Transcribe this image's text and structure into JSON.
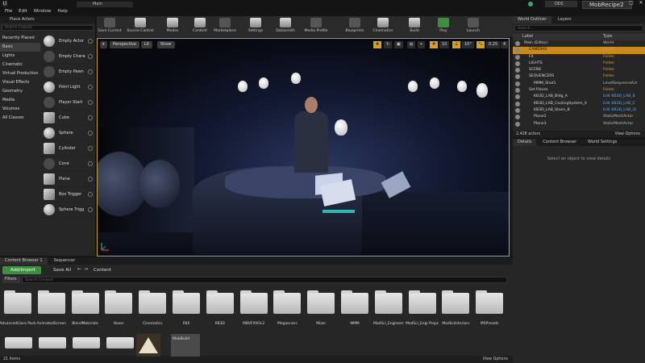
{
  "app": {
    "menu": [
      "File",
      "Edit",
      "Window",
      "Help"
    ],
    "doc_tab": "Main",
    "ddc_label": "DDC",
    "project_tab": "MobRecipe2"
  },
  "place_actors": {
    "title": "Place Actors",
    "search_placeholder": "Search Classes",
    "categories": [
      "Recently Placed",
      "Basic",
      "Lights",
      "Cinematic",
      "Virtual Production",
      "Visual Effects",
      "Geometry",
      "Media",
      "Volumes",
      "All Classes"
    ],
    "active_category": "Basic",
    "actors": [
      "Empty Actor",
      "Empty Chara",
      "Empty Pawn",
      "Point Light",
      "Player Start",
      "Cube",
      "Sphere",
      "Cylinder",
      "Cone",
      "Plane",
      "Box Trigger",
      "Sphere Trigg"
    ]
  },
  "toolbar": {
    "buttons": [
      "Save Current",
      "Source Control",
      "Modes",
      "Content",
      "Marketplace",
      "Settings",
      "Datasmith",
      "Media Profile",
      "Blueprints",
      "Cinematics",
      "Build",
      "Play",
      "Launch"
    ]
  },
  "viewport": {
    "perspective": "Perspective",
    "lit": "Lit",
    "show": "Show",
    "grid_snap": "10",
    "rot_snap": "10°",
    "scale_snap": "0.25",
    "cam_speed": "4"
  },
  "outliner": {
    "tab_outliner": "World Outliner",
    "tab_layers": "Layers",
    "search_placeholder": "Search...",
    "col_label": "Label",
    "col_type": "Type",
    "rows": [
      {
        "name": "Main (Editor)",
        "type": "World",
        "indent": 0,
        "tclass": "g",
        "selected": false
      },
      {
        "name": "CAMERAS",
        "type": "Folder",
        "indent": 1,
        "tclass": "",
        "selected": true
      },
      {
        "name": "FX",
        "type": "Folder",
        "indent": 1,
        "tclass": "",
        "selected": false
      },
      {
        "name": "LIGHTS",
        "type": "Folder",
        "indent": 1,
        "tclass": "",
        "selected": false
      },
      {
        "name": "SCENE",
        "type": "Folder",
        "indent": 1,
        "tclass": "",
        "selected": false
      },
      {
        "name": "SEQUENCERS",
        "type": "Folder",
        "indent": 1,
        "tclass": "",
        "selected": false
      },
      {
        "name": "MMM_Shot1",
        "type": "LevelSequenceAct",
        "indent": 2,
        "tclass": "g",
        "selected": false
      },
      {
        "name": "Set Pieces",
        "type": "Folder",
        "indent": 1,
        "tclass": "",
        "selected": false
      },
      {
        "name": "KB3D_LAB_Bldg_A",
        "type": "Edit KB3D_LAB_B",
        "indent": 2,
        "tclass": "b",
        "selected": false
      },
      {
        "name": "KB3D_LAB_CoolingSystem_A",
        "type": "Edit KB3D_LAB_C",
        "indent": 2,
        "tclass": "b",
        "selected": false
      },
      {
        "name": "KB3D_LAB_Stairs_B",
        "type": "Edit KB3D_LAB_St",
        "indent": 2,
        "tclass": "b",
        "selected": false
      },
      {
        "name": "Plane2",
        "type": "StaticMeshActor",
        "indent": 2,
        "tclass": "g",
        "selected": false
      },
      {
        "name": "Plane3",
        "type": "StaticMeshActor",
        "indent": 2,
        "tclass": "g",
        "selected": false
      }
    ],
    "count": "2,428 actors",
    "view_options": "View Options"
  },
  "details": {
    "tab_details": "Details",
    "tab_content_browser": "Content Browser",
    "tab_world_settings": "World Settings",
    "message": "Select an object to view details"
  },
  "content_browser": {
    "tab_cb": "Content Browser 1",
    "tab_seq": "Sequencer",
    "add_import": "Add/Import",
    "save_all": "Save All",
    "path": "Content",
    "filters": "Filters",
    "search_placeholder": "Search Content",
    "folders": [
      "AdvancedGlass Pack",
      "AnimatedScreen",
      "BlendMaterials",
      "Boxer",
      "Cinematics",
      "FBX",
      "KB3D",
      "MBVFXVOL2",
      "Megascans",
      "Mixer",
      "MMM",
      "ModSci_Engineer",
      "ModSci_Engi Props",
      "ModSciInteriors",
      "MSPresets"
    ],
    "mob_build": "MobBuild",
    "items_count": "21 items",
    "view_options": "View Options"
  }
}
